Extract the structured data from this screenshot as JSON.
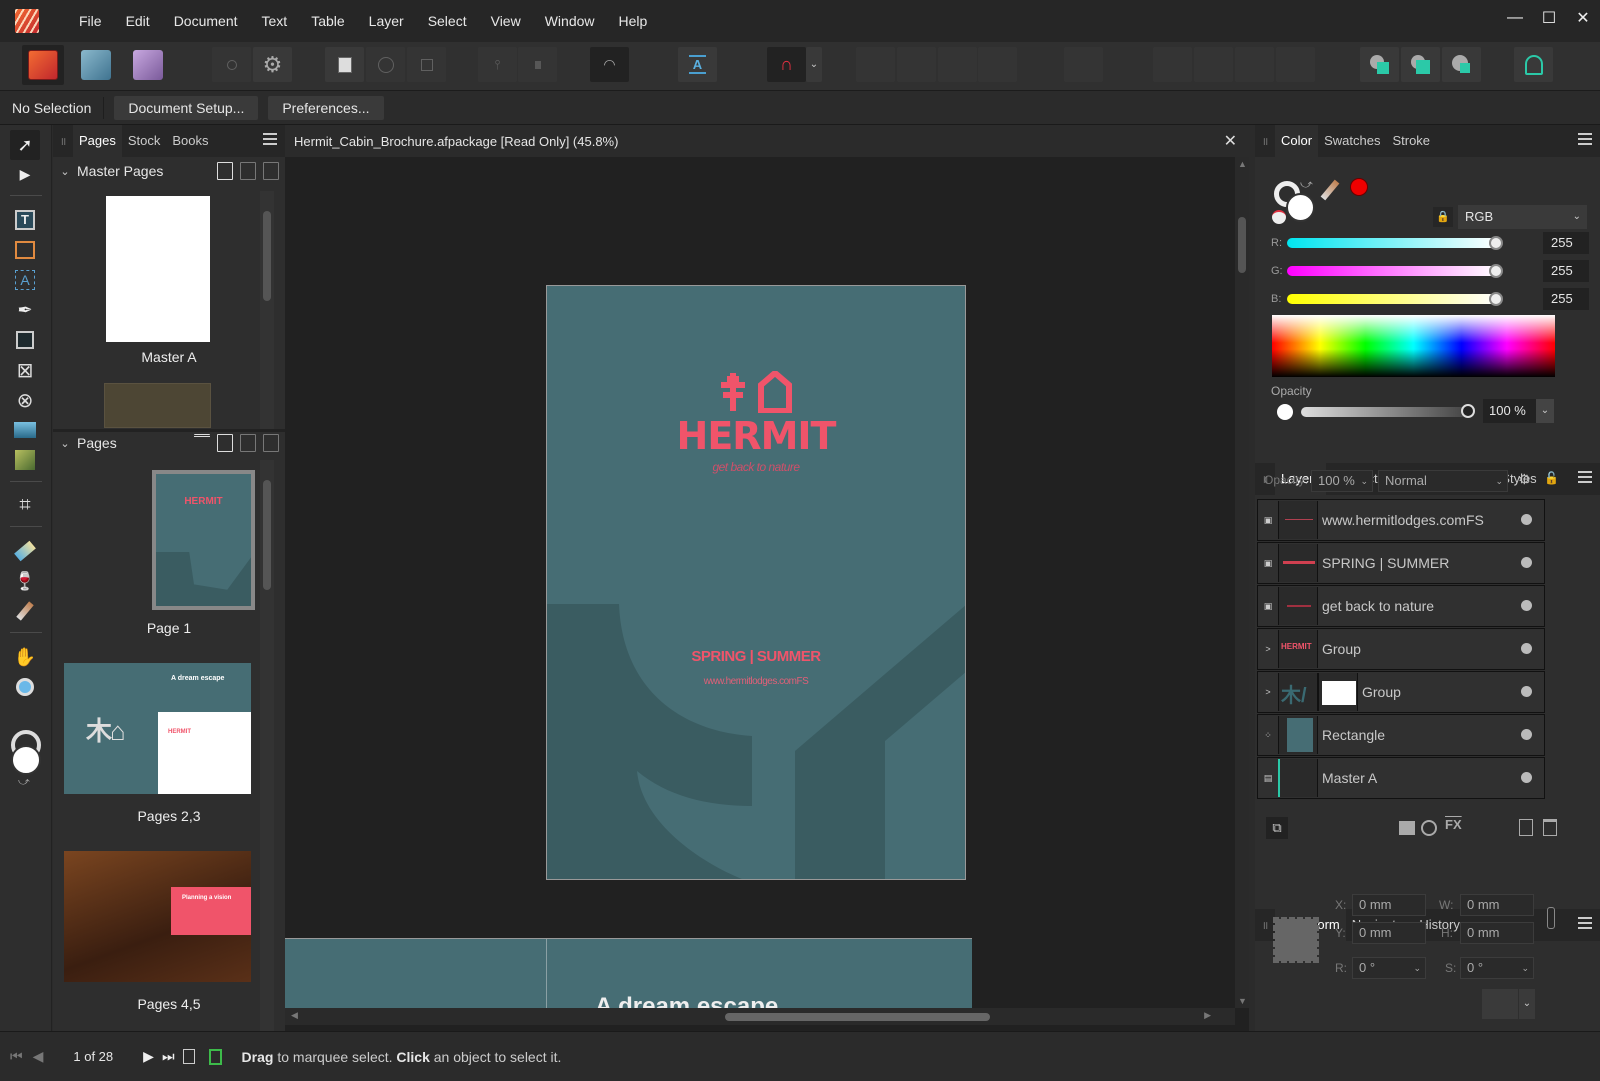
{
  "menubar": {
    "items": [
      "File",
      "Edit",
      "Document",
      "Text",
      "Table",
      "Layer",
      "Select",
      "View",
      "Window",
      "Help"
    ],
    "window_controls": {
      "minimize": "—",
      "maximize": "☐",
      "close": "✕"
    }
  },
  "toolbar": {
    "personas": [
      "publisher-persona",
      "designer-persona",
      "photo-persona"
    ],
    "accent_color": "#2bc9a8"
  },
  "context_bar": {
    "selection_label": "No Selection",
    "document_setup_label": "Document Setup...",
    "preferences_label": "Preferences..."
  },
  "pages_panel": {
    "tabs": [
      "Pages",
      "Stock",
      "Books"
    ],
    "master_pages_heading": "Master Pages",
    "master_pages": [
      {
        "label": "Master A"
      }
    ],
    "pages_heading": "Pages",
    "pages": [
      {
        "label": "Page 1"
      },
      {
        "label": "Pages 2,3",
        "thumb_title": "A dream escape"
      },
      {
        "label": "Pages 4,5",
        "thumb_title": "Planning a vision"
      }
    ]
  },
  "document": {
    "tab_title": "Hermit_Cabin_Brochure.afpackage [Read Only] (45.8%)",
    "cover": {
      "brand": "HERMIT",
      "tagline": "get back to nature",
      "season": "SPRING | SUMMER",
      "url": "www.hermitlodges.comFS",
      "bg_color": "#466d74",
      "accent_color": "#f0546a"
    },
    "next_spread_heading": "A dream escape"
  },
  "color_panel": {
    "tabs": [
      "Color",
      "Swatches",
      "Stroke"
    ],
    "model": "RGB",
    "channels": [
      {
        "label": "R:",
        "value": "255"
      },
      {
        "label": "G:",
        "value": "255"
      },
      {
        "label": "B:",
        "value": "255"
      }
    ],
    "opacity_label": "Opacity",
    "opacity_value": "100 %"
  },
  "layers_panel": {
    "tabs": [
      "Layers",
      "Character",
      "Paragraph",
      "Text Styles"
    ],
    "opacity_label": "Opacity:",
    "opacity_value": "100 %",
    "blend_mode": "Normal",
    "layers": [
      {
        "name": "www.hermitlodges.comFS",
        "type": "text"
      },
      {
        "name": "SPRING | SUMMER",
        "type": "text"
      },
      {
        "name": "get back to nature",
        "type": "text"
      },
      {
        "name": "Group",
        "type": "group"
      },
      {
        "name": "Group",
        "type": "group"
      },
      {
        "name": "Rectangle",
        "type": "shape"
      },
      {
        "name": "Master A",
        "type": "master"
      }
    ]
  },
  "transform_panel": {
    "tabs": [
      "Transform",
      "Navigator",
      "History"
    ],
    "x_label": "X:",
    "x": "0 mm",
    "y_label": "Y:",
    "y": "0 mm",
    "w_label": "W:",
    "w": "0 mm",
    "h_label": "H:",
    "h": "0 mm",
    "r_label": "R:",
    "r": "0 °",
    "s_label": "S:",
    "s": "0 °"
  },
  "status_bar": {
    "page_indicator": "1 of 28",
    "hint_drag": "Drag",
    "hint_mid": " to marquee select. ",
    "hint_click": "Click",
    "hint_end": " an object to select it."
  }
}
